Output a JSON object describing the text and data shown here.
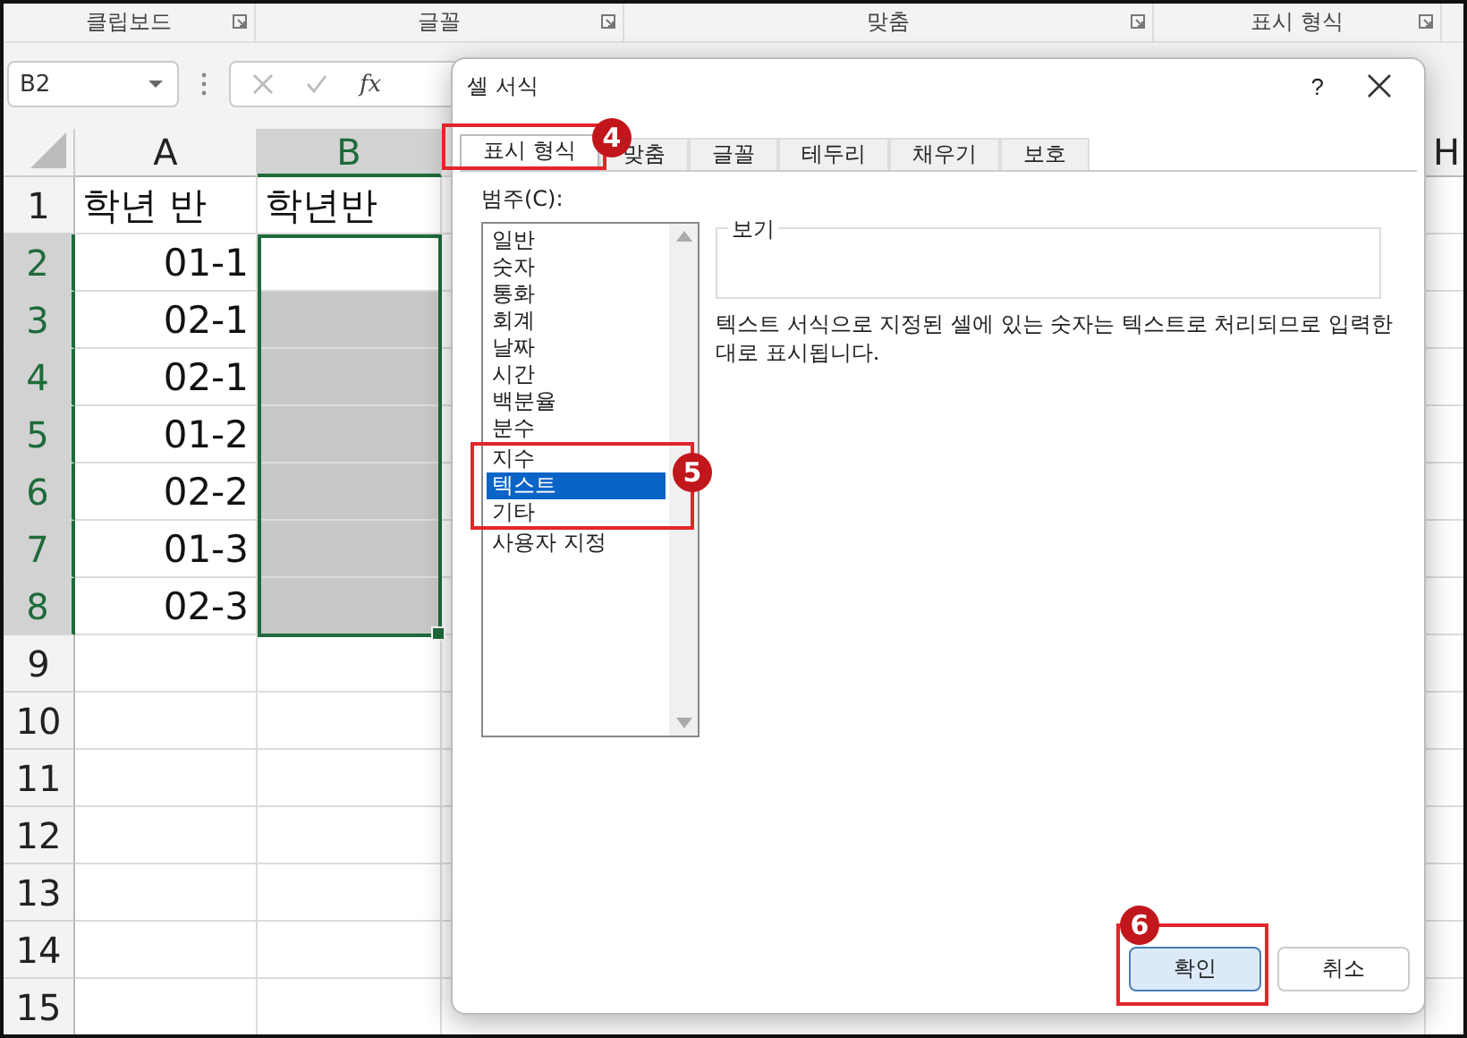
{
  "ribbon": {
    "groups": [
      {
        "label": "클립보드"
      },
      {
        "label": "글꼴"
      },
      {
        "label": "맞춤"
      },
      {
        "label": "표시 형식"
      }
    ]
  },
  "formula_bar": {
    "name_box": "B2",
    "fx": "fx"
  },
  "sheet": {
    "columns": [
      {
        "label": "A",
        "selected": false,
        "kind": "normal"
      },
      {
        "label": "B",
        "selected": true,
        "kind": "normal"
      },
      {
        "label": "H",
        "selected": false,
        "kind": "edge"
      }
    ],
    "rows": [
      {
        "number": "1",
        "selected": false,
        "cells": [
          {
            "text": "학년 반",
            "kind": "text",
            "selected": false
          },
          {
            "text": "학년반",
            "kind": "text",
            "selected": false
          }
        ]
      },
      {
        "number": "2",
        "selected": true,
        "cells": [
          {
            "text": "01-1",
            "kind": "number",
            "selected": false
          },
          {
            "kind": "text",
            "selected": true,
            "active": true
          }
        ]
      },
      {
        "number": "3",
        "selected": true,
        "cells": [
          {
            "text": "02-1",
            "kind": "number",
            "selected": false
          },
          {
            "kind": "text",
            "selected": true
          }
        ]
      },
      {
        "number": "4",
        "selected": true,
        "cells": [
          {
            "text": "02-1",
            "kind": "number",
            "selected": false
          },
          {
            "kind": "text",
            "selected": true
          }
        ]
      },
      {
        "number": "5",
        "selected": true,
        "cells": [
          {
            "text": "01-2",
            "kind": "number",
            "selected": false
          },
          {
            "kind": "text",
            "selected": true
          }
        ]
      },
      {
        "number": "6",
        "selected": true,
        "cells": [
          {
            "text": "02-2",
            "kind": "number",
            "selected": false
          },
          {
            "kind": "text",
            "selected": true
          }
        ]
      },
      {
        "number": "7",
        "selected": true,
        "cells": [
          {
            "text": "01-3",
            "kind": "number",
            "selected": false
          },
          {
            "kind": "text",
            "selected": true
          }
        ]
      },
      {
        "number": "8",
        "selected": true,
        "cells": [
          {
            "text": "02-3",
            "kind": "number",
            "selected": false
          },
          {
            "kind": "text",
            "selected": true
          }
        ]
      },
      {
        "number": "9",
        "selected": false,
        "cells": []
      },
      {
        "number": "10",
        "selected": false,
        "cells": []
      },
      {
        "number": "11",
        "selected": false,
        "cells": []
      },
      {
        "number": "12",
        "selected": false,
        "cells": []
      },
      {
        "number": "13",
        "selected": false,
        "cells": []
      },
      {
        "number": "14",
        "selected": false,
        "cells": []
      },
      {
        "number": "15",
        "selected": false,
        "cells": []
      }
    ]
  },
  "dialog": {
    "title": "셀 서식",
    "help": "?",
    "tabs": [
      {
        "label": "표시 형식",
        "selected": true
      },
      {
        "label": "맞춤",
        "selected": false
      },
      {
        "label": "글꼴",
        "selected": false
      },
      {
        "label": "테두리",
        "selected": false
      },
      {
        "label": "채우기",
        "selected": false
      },
      {
        "label": "보호",
        "selected": false
      }
    ],
    "category_label": "범주(C):",
    "categories": [
      {
        "label": "일반",
        "selected": false
      },
      {
        "label": "숫자",
        "selected": false
      },
      {
        "label": "통화",
        "selected": false
      },
      {
        "label": "회계",
        "selected": false
      },
      {
        "label": "날짜",
        "selected": false
      },
      {
        "label": "시간",
        "selected": false
      },
      {
        "label": "백분율",
        "selected": false
      },
      {
        "label": "분수",
        "selected": false
      },
      {
        "label": "지수",
        "selected": false
      },
      {
        "label": "텍스트",
        "selected": true
      },
      {
        "label": "기타",
        "selected": false
      },
      {
        "label": "사용자 지정",
        "selected": false
      }
    ],
    "preview_label": "보기",
    "description": "텍스트 서식으로 지정된 셀에 있는 숫자는 텍스트로 처리되므로 입력한 대로 표시됩니다.",
    "buttons": [
      {
        "label": "확인",
        "kind": "primary"
      },
      {
        "label": "취소",
        "kind": "secondary"
      }
    ]
  },
  "callouts": [
    {
      "number": "4",
      "kind": "tab"
    },
    {
      "number": "5",
      "kind": "list"
    },
    {
      "number": "6",
      "kind": "button"
    }
  ]
}
